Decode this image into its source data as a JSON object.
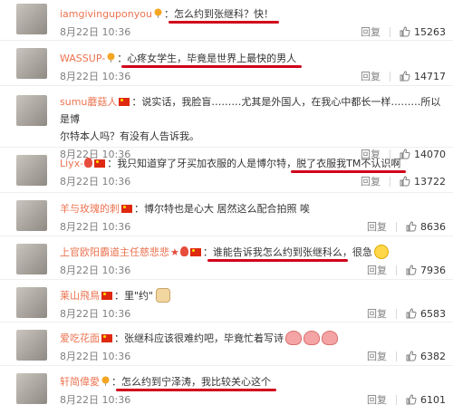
{
  "comments": [
    {
      "user": "iamgivinguponyou",
      "text_highlight": "怎么约到张继科？快！",
      "text_after": "",
      "time": "8月22日 10:36",
      "reply": "回复",
      "likes": "15263"
    },
    {
      "user": "WASSUP-",
      "text_before": "",
      "text_highlight": "心疼女学生，毕竟是世界上最快的男人",
      "time": "8月22日 10:36",
      "reply": "回复",
      "likes": "14717"
    },
    {
      "user": "sumu蘑菇人",
      "text": "说实话，我脸盲………尤其是外国人，在我心中都长一样………所以是博",
      "text_line2": "尔特本人吗？有没有人告诉我。",
      "time": "8月22日 10:36",
      "reply": "回复",
      "likes": "14070"
    },
    {
      "user": "Liyx-",
      "text_before": "我只知道穿了牙买加衣服的人是博尔特，",
      "text_highlight": "脱了衣服我TM不认识啊",
      "time": "8月22日 10:36",
      "reply": "回复",
      "likes": "13722"
    },
    {
      "user": "羊与玫瑰的刺",
      "text": "博尔特也是心大 居然这么配合拍照 唉",
      "time": "8月22日 10:36",
      "reply": "回复",
      "likes": "8636"
    },
    {
      "user": "上官欧阳霸道主任慈悲悲",
      "text_highlight": "谁能告诉我怎么约到张继科么",
      "text_after": "，很急",
      "time": "8月22日 10:36",
      "reply": "回复",
      "likes": "7936"
    },
    {
      "user": "莱山飛鳥",
      "text": "里\"约\"",
      "time": "8月22日 10:36",
      "reply": "回复",
      "likes": "6583"
    },
    {
      "user": "爱吃花面",
      "text": "张继科应该很难约吧，毕竟忙着写诗",
      "time": "8月22日 10:36",
      "reply": "回复",
      "likes": "6382"
    },
    {
      "user": "轩简偉愛",
      "text_highlight": "怎么约到宁泽涛，我比较关心这个",
      "time": "8月22日 10:36",
      "reply": "回复",
      "likes": "6101"
    }
  ],
  "colors": {
    "username": "#eb7350",
    "underline": "#d0021b",
    "meta": "#808080"
  }
}
